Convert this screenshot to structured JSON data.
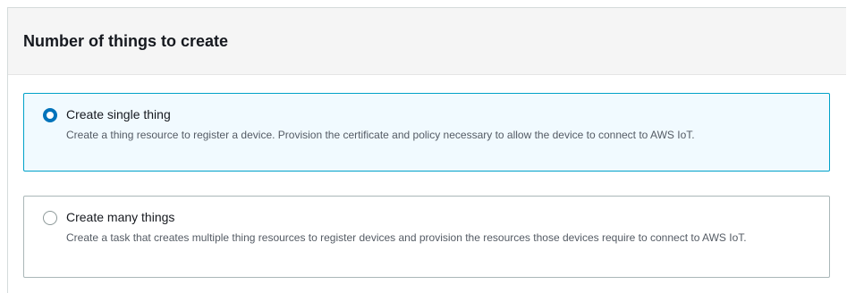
{
  "section": {
    "title": "Number of things to create"
  },
  "options": [
    {
      "label": "Create single thing",
      "description": "Create a thing resource to register a device. Provision the certificate and policy necessary to allow the device to connect to AWS IoT.",
      "selected": true
    },
    {
      "label": "Create many things",
      "description": "Create a task that creates multiple thing resources to register devices and provision the resources those devices require to connect to AWS IoT.",
      "selected": false
    }
  ],
  "colors": {
    "selected_border": "#00a1c9",
    "selected_background": "#f1faff",
    "radio_accent": "#0073bb",
    "header_background": "#f5f5f5"
  }
}
